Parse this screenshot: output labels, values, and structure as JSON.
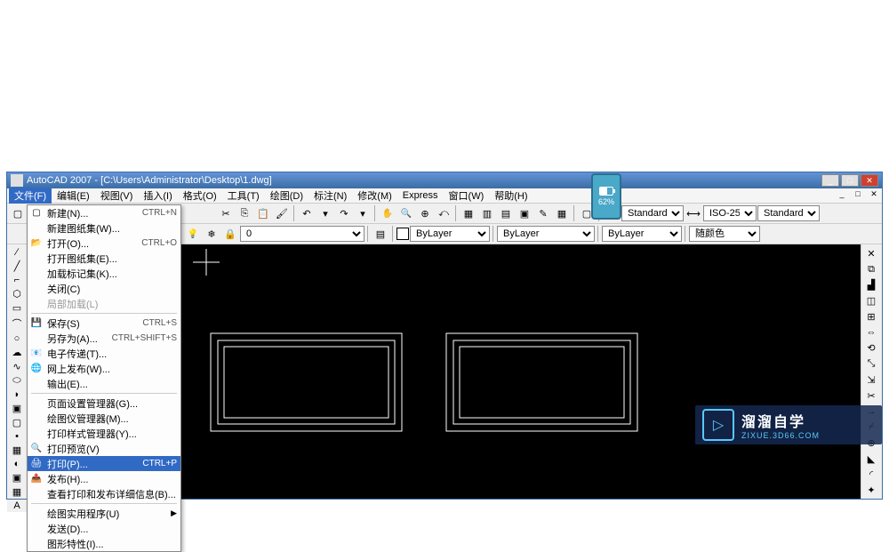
{
  "window": {
    "title": "AutoCAD 2007 - [C:\\Users\\Administrator\\Desktop\\1.dwg]"
  },
  "menubar": {
    "items": [
      "文件(F)",
      "编辑(E)",
      "视图(V)",
      "插入(I)",
      "格式(O)",
      "工具(T)",
      "绘图(D)",
      "标注(N)",
      "修改(M)",
      "Express",
      "窗口(W)",
      "帮助(H)"
    ]
  },
  "toolbar1": {
    "text_style": "Standard",
    "dim_style": "ISO-25",
    "table_style": "Standard"
  },
  "toolbar2": {
    "layer_dropdown": "0",
    "layer_linetype": "ByLayer",
    "linetype": "ByLayer",
    "lineweight": "ByLayer",
    "color": "随颜色"
  },
  "dropdown": {
    "items": [
      {
        "type": "item",
        "icon": "▢",
        "label": "新建(N)...",
        "shortcut": "CTRL+N"
      },
      {
        "type": "item",
        "icon": "",
        "label": "新建图纸集(W)...",
        "shortcut": ""
      },
      {
        "type": "item",
        "icon": "📂",
        "label": "打开(O)...",
        "shortcut": "CTRL+O"
      },
      {
        "type": "item",
        "icon": "",
        "label": "打开图纸集(E)...",
        "shortcut": ""
      },
      {
        "type": "item",
        "icon": "",
        "label": "加载标记集(K)...",
        "shortcut": ""
      },
      {
        "type": "item",
        "icon": "",
        "label": "关闭(C)",
        "shortcut": ""
      },
      {
        "type": "item",
        "icon": "",
        "label": "局部加载(L)",
        "shortcut": "",
        "disabled": true
      },
      {
        "type": "sep"
      },
      {
        "type": "item",
        "icon": "💾",
        "label": "保存(S)",
        "shortcut": "CTRL+S"
      },
      {
        "type": "item",
        "icon": "",
        "label": "另存为(A)...",
        "shortcut": "CTRL+SHIFT+S"
      },
      {
        "type": "item",
        "icon": "📧",
        "label": "电子传递(T)...",
        "shortcut": ""
      },
      {
        "type": "item",
        "icon": "🌐",
        "label": "网上发布(W)...",
        "shortcut": ""
      },
      {
        "type": "item",
        "icon": "",
        "label": "输出(E)...",
        "shortcut": ""
      },
      {
        "type": "sep"
      },
      {
        "type": "item",
        "icon": "",
        "label": "页面设置管理器(G)...",
        "shortcut": ""
      },
      {
        "type": "item",
        "icon": "",
        "label": "绘图仪管理器(M)...",
        "shortcut": ""
      },
      {
        "type": "item",
        "icon": "",
        "label": "打印样式管理器(Y)...",
        "shortcut": ""
      },
      {
        "type": "item",
        "icon": "🔍",
        "label": "打印预览(V)",
        "shortcut": ""
      },
      {
        "type": "item",
        "icon": "🖨",
        "label": "打印(P)...",
        "shortcut": "CTRL+P",
        "highlighted": true
      },
      {
        "type": "item",
        "icon": "📤",
        "label": "发布(H)...",
        "shortcut": ""
      },
      {
        "type": "item",
        "icon": "",
        "label": "查看打印和发布详细信息(B)...",
        "shortcut": ""
      },
      {
        "type": "sep"
      },
      {
        "type": "item",
        "icon": "",
        "label": "绘图实用程序(U)",
        "shortcut": "",
        "arrow": true
      },
      {
        "type": "item",
        "icon": "",
        "label": "发送(D)...",
        "shortcut": ""
      },
      {
        "type": "item",
        "icon": "",
        "label": "图形特性(I)...",
        "shortcut": ""
      }
    ]
  },
  "phone": {
    "percent": "62%"
  },
  "watermark": {
    "title": "溜溜自学",
    "sub": "ZIXUE.3D66.COM"
  }
}
